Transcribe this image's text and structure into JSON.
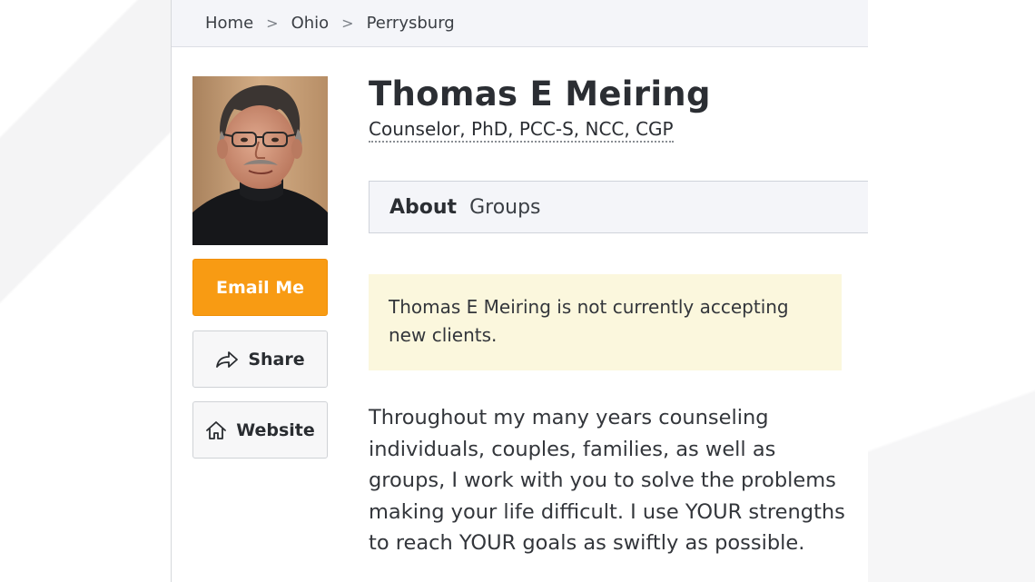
{
  "breadcrumb": {
    "items": [
      "Home",
      "Ohio",
      "Perrysburg"
    ],
    "separator": ">"
  },
  "profile": {
    "name": "Thomas E Meiring",
    "credentials": "Counselor, PhD, PCC-S, NCC, CGP",
    "photo_alt": "profile-photo"
  },
  "actions": {
    "email_label": "Email Me",
    "share_label": "Share",
    "website_label": "Website"
  },
  "tabs": {
    "about": "About",
    "groups": "Groups"
  },
  "notice": {
    "text": "Thomas E Meiring is not currently accepting new clients."
  },
  "bio": {
    "text": "Throughout my many years counseling individuals, couples, families, as well as groups, I work with you to solve the problems making your life difficult. I use YOUR strengths to reach YOUR goals as swiftly as possible."
  },
  "colors": {
    "email_button": "#f89b13",
    "notice_background": "#fbf7dd",
    "breadcrumb_background": "#f4f5f9"
  }
}
